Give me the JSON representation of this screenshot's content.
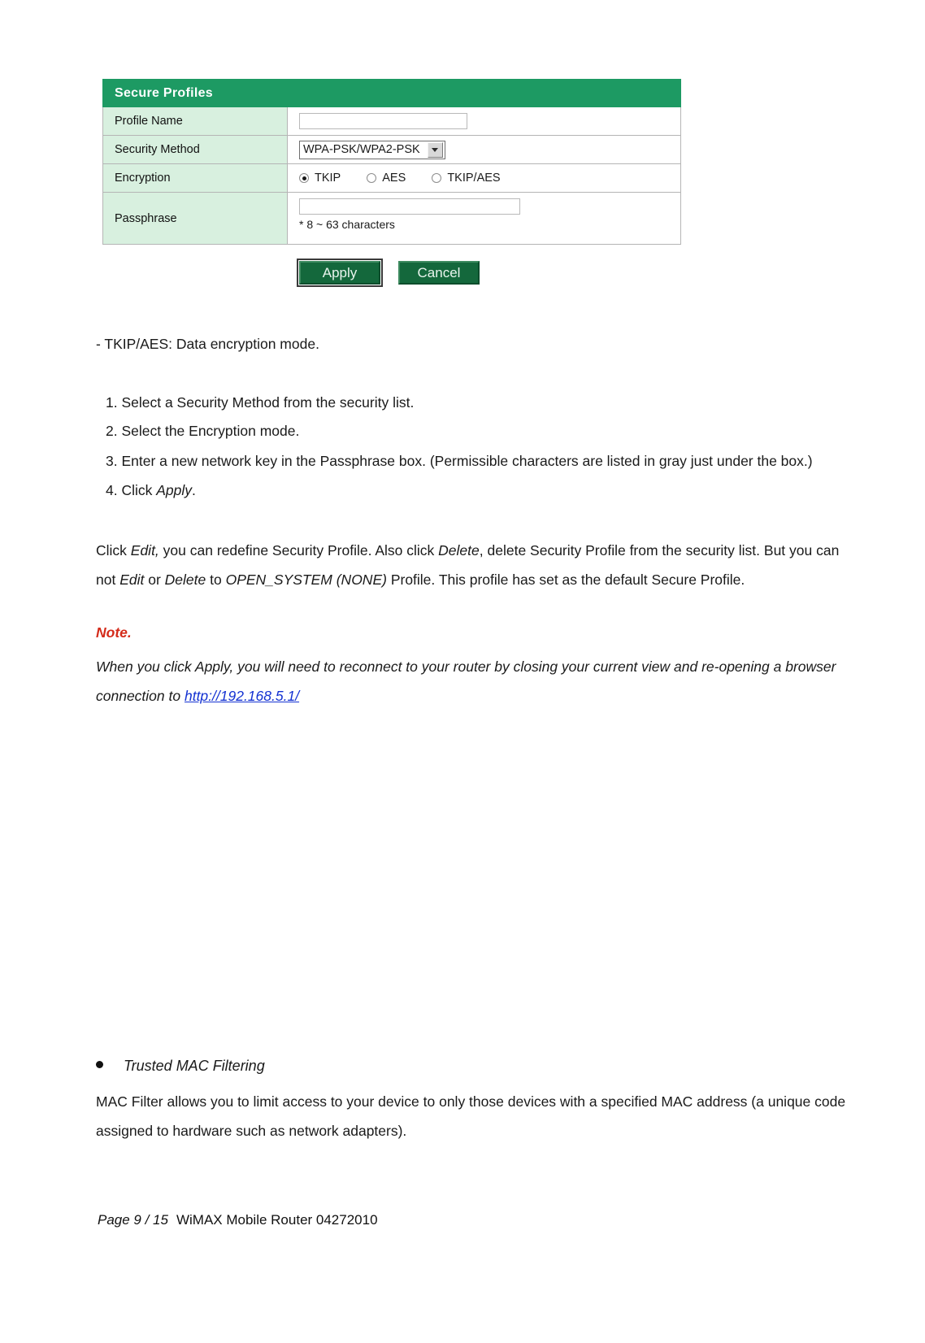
{
  "panel": {
    "header_title": "Secure Profiles",
    "header_color": "#1d9a63",
    "label_bg_color": "#d8f0df",
    "rows": {
      "profile_name": {
        "label": "Profile Name",
        "input_value": "",
        "input_placeholder": ""
      },
      "security_method": {
        "label": "Security Method",
        "selected_option": "WPA-PSK/WPA2-PSK"
      },
      "encryption": {
        "label": "Encryption",
        "options": [
          {
            "label": "TKIP",
            "checked": true
          },
          {
            "label": "AES",
            "checked": false
          },
          {
            "label": "TKIP/AES",
            "checked": false
          }
        ]
      },
      "passphrase": {
        "label": "Passphrase",
        "input_value": "",
        "input_placeholder": "",
        "hint": "* 8 ~ 63 characters"
      }
    },
    "buttons": {
      "apply": "Apply",
      "cancel": "Cancel"
    }
  },
  "content": {
    "dash_line": "-  TKIP/AES: Data encryption mode.",
    "steps": [
      "1. Select a Security Method from the security list.",
      "2. Select the Encryption mode.",
      "3. Enter a new network key in the Passphrase box. (Permissible characters are listed in gray just under the box.)",
      "4. Click Apply."
    ],
    "step4_prefix": "4. Click ",
    "step4_italic": "Apply",
    "step4_suffix": ".",
    "edit_para": {
      "seg1": "Click ",
      "em1": "Edit,",
      "seg2": " you can redefine Security Profile. Also click ",
      "em2": "Delete",
      "seg3": ", delete Security Profile from the security list. But you can not ",
      "em3": "Edit",
      "seg4": " or ",
      "em4": "Delete",
      "seg5": " to ",
      "em5": "OPEN_SYSTEM (NONE)",
      "seg6": " Profile. This profile has set as the default Secure Profile."
    },
    "note": {
      "heading": "Note.",
      "body_prefix": "When you click Apply, you will need to reconnect to your router by closing your current view and re-opening a browser connection to ",
      "link_text": "http://192.168.5.1/",
      "link_color": "#1432d2"
    },
    "section": {
      "bullet_heading": "Trusted MAC Filtering",
      "paragraph": "MAC Filter allows you to limit access to your device to only those devices with a specified MAC address (a unique code assigned to hardware such as network adapters)."
    }
  },
  "footer": {
    "page_number": "Page 9 / 15",
    "document_id": "WiMAX Mobile Router 04272010"
  }
}
